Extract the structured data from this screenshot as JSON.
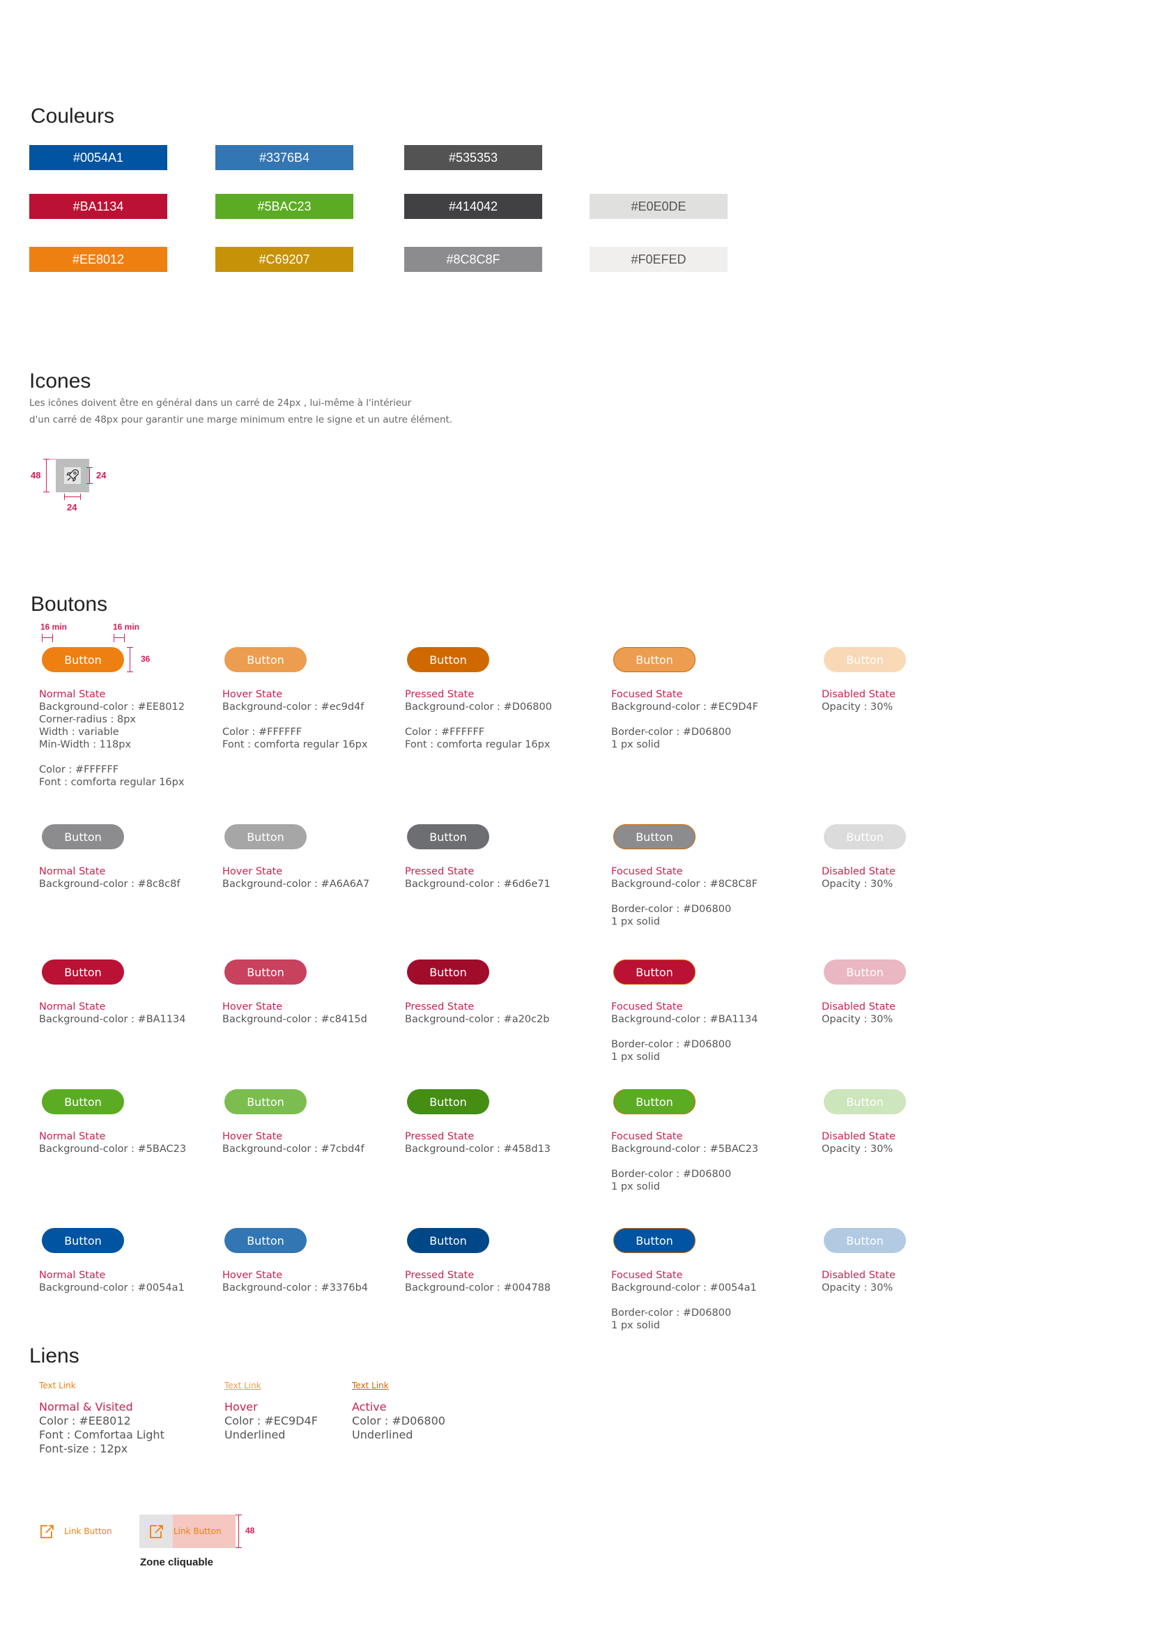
{
  "colors": {
    "title": "Couleurs",
    "swatches": [
      {
        "label": "#0054A1",
        "color": "#0054A1"
      },
      {
        "label": "#3376B4",
        "color": "#3376B4"
      },
      {
        "label": "#535353",
        "color": "#535353"
      },
      {
        "label": "#BA1134",
        "color": "#BA1134"
      },
      {
        "label": "#5BAC23",
        "color": "#5BAC23"
      },
      {
        "label": "#414042",
        "color": "#414042"
      },
      {
        "label": "#E0E0DE",
        "color": "#E0E0DE"
      },
      {
        "label": "#EE8012",
        "color": "#EE8012"
      },
      {
        "label": "#C69207",
        "color": "#C69207"
      },
      {
        "label": "#8C8C8F",
        "color": "#8C8C8F"
      },
      {
        "label": "#F0EFED",
        "color": "#F0EFED"
      }
    ]
  },
  "icons": {
    "title": "Icones",
    "desc_line1": "Les icônes doivent être en général dans un carré de 24px , lui-même à l'intérieur",
    "desc_line2": "d'un carré de 48px pour garantir une marge minimum entre le signe et un autre élément.",
    "dim_outer": "48",
    "dim_inner_right": "24",
    "dim_inner_bottom": "24",
    "sample_icon": "rocket-icon"
  },
  "buttons": {
    "title": "Boutons",
    "dim_padding_left": "16 min",
    "dim_padding_right": "16 min",
    "dim_height": "36",
    "label": "Button",
    "rows": [
      {
        "states": [
          {
            "color": "#EE8012",
            "kind": "normal",
            "state": "Normal State",
            "lines": [
              "Background-color : #EE8012",
              "Corner-radius : 8px",
              "Width : variable",
              "Min-Width : 118px",
              "",
              "Color : #FFFFFF",
              "Font : comforta regular 16px"
            ]
          },
          {
            "color": "#EC9D4F",
            "kind": "normal",
            "state": "Hover State",
            "lines": [
              "Background-color : #ec9d4f",
              "",
              "Color : #FFFFFF",
              "Font : comforta regular 16px"
            ]
          },
          {
            "color": "#D06800",
            "kind": "normal",
            "state": "Pressed State",
            "lines": [
              "Background-color : #D06800",
              "",
              "Color : #FFFFFF",
              "Font : comforta regular 16px"
            ]
          },
          {
            "color": "#EC9D4F",
            "kind": "focused",
            "state": "Focused State",
            "lines": [
              "Background-color : #EC9D4F",
              "",
              "Border-color : #D06800",
              "1 px solid"
            ]
          },
          {
            "color": "#EE8012",
            "kind": "disabled",
            "state": "Disabled State",
            "lines": [
              "Opacity : 30%"
            ]
          }
        ]
      },
      {
        "states": [
          {
            "color": "#8C8C8F",
            "kind": "normal",
            "state": "Normal State",
            "lines": [
              "Background-color : #8c8c8f"
            ]
          },
          {
            "color": "#A6A6A7",
            "kind": "normal",
            "state": "Hover State",
            "lines": [
              "Background-color : #A6A6A7"
            ]
          },
          {
            "color": "#6D6E71",
            "kind": "normal",
            "state": "Pressed State",
            "lines": [
              "Background-color : #6d6e71"
            ]
          },
          {
            "color": "#8C8C8F",
            "kind": "focused",
            "state": "Focused State",
            "lines": [
              "Background-color : #8C8C8F",
              "",
              "Border-color : #D06800",
              "1 px solid"
            ]
          },
          {
            "color": "#8C8C8F",
            "kind": "disabled",
            "state": "Disabled State",
            "lines": [
              "Opacity : 30%"
            ]
          }
        ]
      },
      {
        "states": [
          {
            "color": "#BA1134",
            "kind": "normal",
            "state": "Normal State",
            "lines": [
              "Background-color : #BA1134"
            ]
          },
          {
            "color": "#C8415D",
            "kind": "normal",
            "state": "Hover State",
            "lines": [
              "Background-color : #c8415d"
            ]
          },
          {
            "color": "#A20C2B",
            "kind": "normal",
            "state": "Pressed State",
            "lines": [
              "Background-color : #a20c2b"
            ]
          },
          {
            "color": "#BA1134",
            "kind": "focused",
            "state": "Focused State",
            "lines": [
              "Background-color : #BA1134",
              "",
              "Border-color : #D06800",
              "1 px solid"
            ]
          },
          {
            "color": "#BA1134",
            "kind": "disabled",
            "state": "Disabled State",
            "lines": [
              "Opacity : 30%"
            ]
          }
        ]
      },
      {
        "states": [
          {
            "color": "#5BAC23",
            "kind": "normal",
            "state": "Normal State",
            "lines": [
              "Background-color : #5BAC23"
            ]
          },
          {
            "color": "#7CBD4F",
            "kind": "normal",
            "state": "Hover State",
            "lines": [
              "Background-color : #7cbd4f"
            ]
          },
          {
            "color": "#458D13",
            "kind": "normal",
            "state": "Pressed State",
            "lines": [
              "Background-color : #458d13"
            ]
          },
          {
            "color": "#5BAC23",
            "kind": "focused",
            "state": "Focused State",
            "lines": [
              "Background-color : #5BAC23",
              "",
              "Border-color : #D06800",
              "1 px solid"
            ]
          },
          {
            "color": "#5BAC23",
            "kind": "disabled",
            "state": "Disabled State",
            "lines": [
              "Opacity : 30%"
            ]
          }
        ]
      },
      {
        "states": [
          {
            "color": "#0054A1",
            "kind": "normal",
            "state": "Normal State",
            "lines": [
              "Background-color : #0054a1"
            ]
          },
          {
            "color": "#3376B4",
            "kind": "normal",
            "state": "Hover State",
            "lines": [
              "Background-color : #3376b4"
            ]
          },
          {
            "color": "#004788",
            "kind": "normal",
            "state": "Pressed State",
            "lines": [
              "Background-color : #004788"
            ]
          },
          {
            "color": "#0054A1",
            "kind": "focused",
            "state": "Focused State",
            "lines": [
              "Background-color : #0054a1",
              "",
              "Border-color : #D06800",
              "1 px solid"
            ]
          },
          {
            "color": "#0054A1",
            "kind": "disabled",
            "state": "Disabled State",
            "lines": [
              "Opacity : 30%"
            ]
          }
        ]
      }
    ]
  },
  "links": {
    "title": "Liens",
    "items": [
      {
        "sample": "Text Link",
        "state": "Normal & Visited",
        "lines": [
          "Color : #EE8012",
          "Font : Comfortaa Light",
          "Font-size : 12px"
        ]
      },
      {
        "sample": "Text Link",
        "state": "Hover",
        "lines": [
          "Color : #EC9D4F",
          "Underlined"
        ]
      },
      {
        "sample": "Text Link",
        "state": "Active",
        "lines": [
          "Color : #D06800",
          "Underlined"
        ]
      }
    ],
    "link_button_label": "Link Button",
    "link_button_zone_label": "Link Button",
    "zone_dim": "48",
    "zone_caption": "Zone cliquable",
    "link_icon": "external-link-icon"
  }
}
